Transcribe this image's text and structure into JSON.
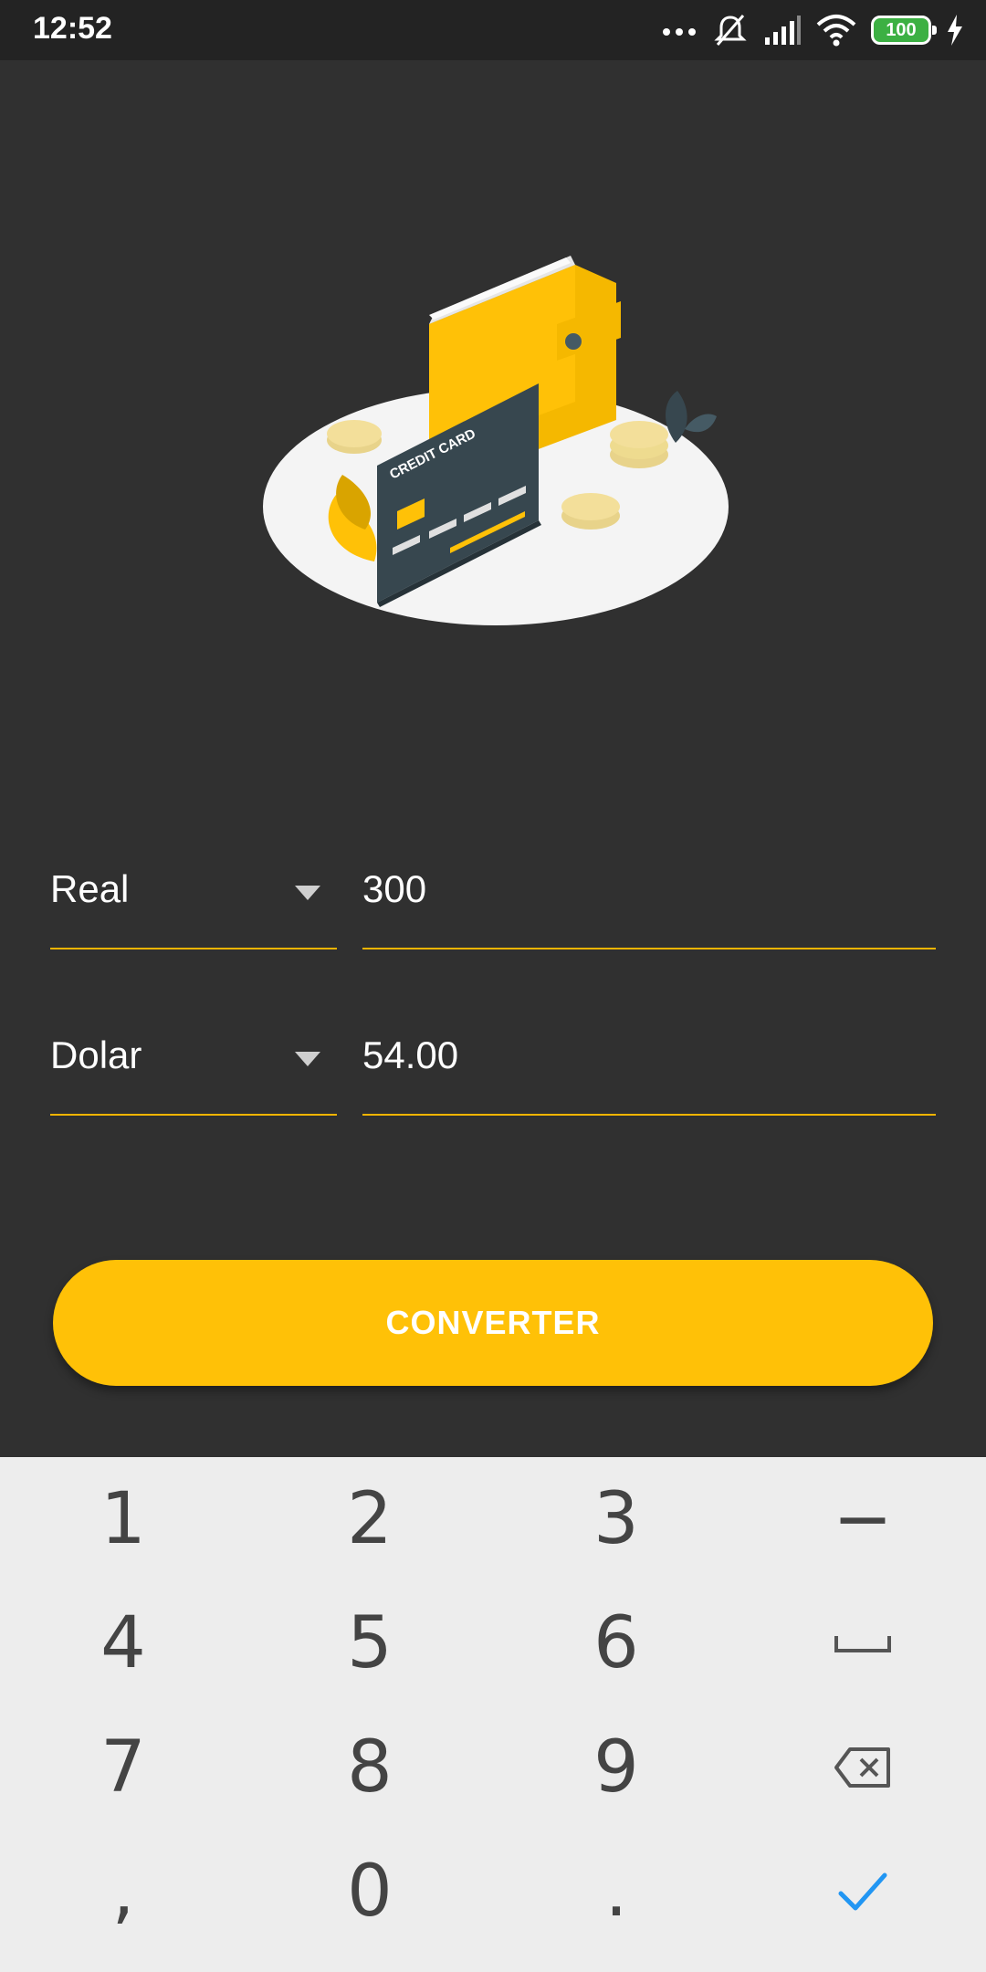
{
  "status_bar": {
    "time": "12:52",
    "battery": "100",
    "icons": [
      "more-dots-icon",
      "silent-icon",
      "signal-icon",
      "wifi-icon",
      "battery-icon",
      "charging-icon"
    ]
  },
  "colors": {
    "background": "#303030",
    "accent": "#ffc107",
    "underline": "#f4b400",
    "keyboard_bg": "#ededed",
    "confirm_check": "#2196f3"
  },
  "illustration": {
    "card_text": "CREDIT CARD",
    "icon": "wallet-credit-card-illustration"
  },
  "converter": {
    "from_currency": "Real",
    "from_amount": "300",
    "to_currency": "Dolar",
    "to_amount": "54.00",
    "button_label": "CONVERTER"
  },
  "keyboard": {
    "keys": [
      "1",
      "2",
      "3",
      "−",
      "4",
      "5",
      "6",
      "space",
      "7",
      "8",
      "9",
      "backspace",
      ",",
      "0",
      ".",
      "done"
    ]
  }
}
